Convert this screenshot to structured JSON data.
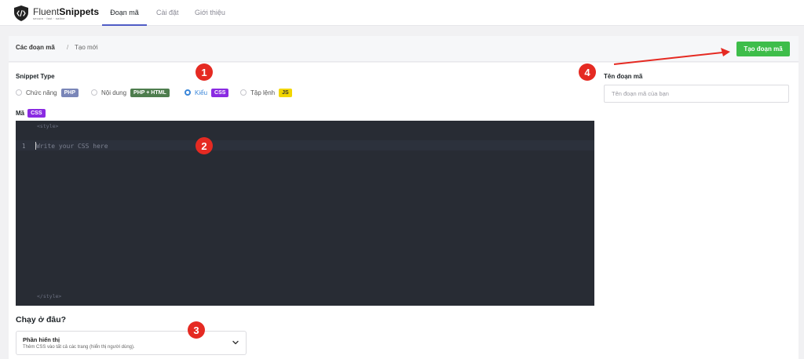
{
  "app": {
    "logo_name_light": "Fluent",
    "logo_name_bold": "Snippets",
    "logo_tagline": "secure · fast · native"
  },
  "nav": {
    "tabs": [
      {
        "label": "Đoạn mã",
        "active": true
      },
      {
        "label": "Cài đặt",
        "active": false
      },
      {
        "label": "Giới thiệu",
        "active": false
      }
    ]
  },
  "breadcrumb": {
    "main": "Các đoạn mã",
    "separator": "/",
    "current": "Tạo mới"
  },
  "toolbar": {
    "create_label": "Tạo đoạn mã"
  },
  "snippet_type": {
    "label": "Snippet Type",
    "options": [
      {
        "label": "Chức năng",
        "badge": "PHP",
        "badge_color": "#7a86b8",
        "checked": false
      },
      {
        "label": "Nội dung",
        "badge": "PHP + HTML",
        "badge_color": "#4e7d4e",
        "checked": false
      },
      {
        "label": "Kiểu",
        "badge": "CSS",
        "badge_color": "#8a2be2",
        "checked": true
      },
      {
        "label": "Tập lệnh",
        "badge": "JS",
        "badge_color": "#f2d600",
        "checked": false
      }
    ]
  },
  "code": {
    "label": "Mã",
    "badge": "CSS",
    "open_tag": "<style>",
    "close_tag": "</style>",
    "line_number": "1",
    "placeholder": "Write your CSS here"
  },
  "run_location": {
    "title": "Chạy ở đâu?",
    "selected_main": "Phần hiển thị",
    "selected_sub": "Thêm CSS vào tất cả các trang (hiển thị người dùng)."
  },
  "snippet_name": {
    "label": "Tên đoạn mã",
    "placeholder": "Tên đoạn mã của bạn"
  },
  "markers": [
    "1",
    "2",
    "3",
    "4"
  ],
  "colors": {
    "accent": "#4f5cc6",
    "create_button": "#3ebd4a",
    "editor_bg": "#282c34",
    "radio_checked": "#3a86d9",
    "marker": "#e52a22"
  }
}
